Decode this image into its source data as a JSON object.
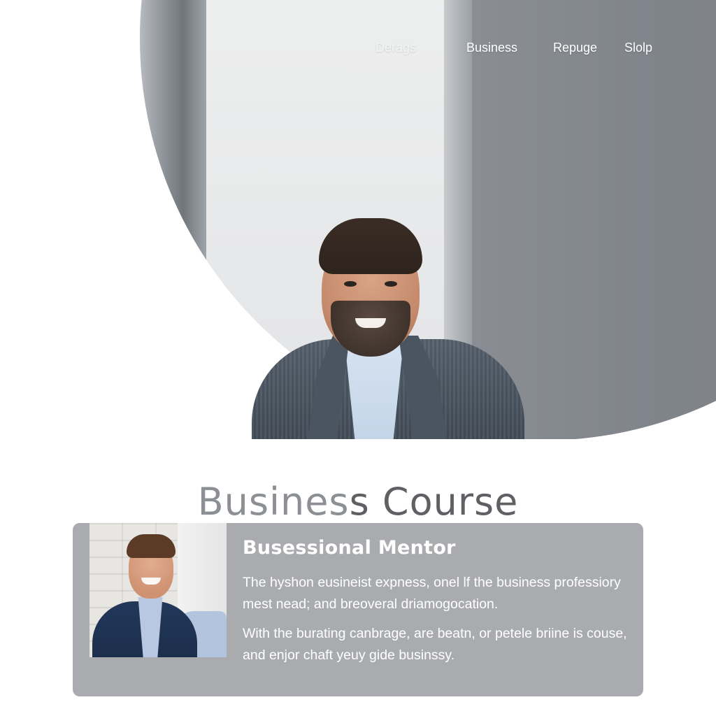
{
  "nav": {
    "items": [
      {
        "label": "Derags"
      },
      {
        "label": "Business"
      },
      {
        "label": "Repuge"
      },
      {
        "label": "Slolp"
      }
    ]
  },
  "hero": {
    "title_part1": "Busines",
    "title_part2": "s Course"
  },
  "mentor_card": {
    "heading": "Busessional Mentor",
    "paragraph1": "The hyshon eusineist expness, onel lf the business professiory mest nead; and breoveral driamogocation.",
    "paragraph2": "With the burating canbrage, are beatn, or petele briine is couse, and enjor chaft yeuy gide businssy."
  },
  "colors": {
    "title_dark": "#5e6064",
    "title_light": "#8c8f93",
    "card_background": "#a9abae",
    "nav_text": "#ffffff"
  }
}
